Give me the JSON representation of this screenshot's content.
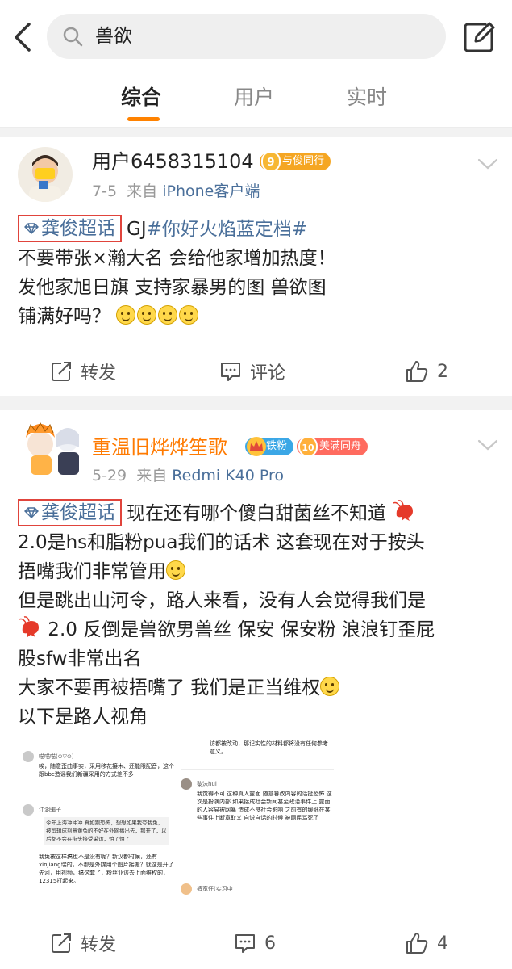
{
  "search": {
    "query": "兽欲"
  },
  "tabs": [
    {
      "label": "综合",
      "active": true
    },
    {
      "label": "用户",
      "active": false
    },
    {
      "label": "实时",
      "active": false
    }
  ],
  "posts": [
    {
      "username": "用户6458315104",
      "badges": [
        {
          "num": "9",
          "label": "与俊同行",
          "color": "#f5a623"
        }
      ],
      "date": "7-5",
      "source_prefix": "来自",
      "source": "iPhone客户端",
      "topic_tag": "龚俊超话",
      "lines": [
        "GJ",
        "#你好火焰蓝定档#",
        "不要带张×瀚大名 会给他家增加热度！",
        " 发他家旭日旗  支持家暴男的图 兽欲图",
        "铺满好吗？"
      ],
      "actions": {
        "repost": "转发",
        "comment": "评论",
        "like": "2"
      }
    },
    {
      "username": "重温旧烨烨笙歌",
      "badges": [
        {
          "label": "铁粉",
          "color": "#3ba7e6"
        },
        {
          "num": "10",
          "label": "美满同舟",
          "color": "#ff6b5f"
        }
      ],
      "date": "5-29",
      "source_prefix": "来自",
      "source": "Redmi K40 Pro",
      "topic_tag": "龚俊超话",
      "lines": [
        "现在还有哪个傻白甜菌丝不知道",
        "2.0是hs和脂粉pua我们的话术  这套现在对于按头",
        "捂嘴我们非常管用",
        "但是跳出山河令，路人来看，没有人会觉得我们是",
        " 2.0 反倒是兽欲男兽丝 保安 保安粉 浪浪钉歪屁",
        "股sfw非常出名",
        "大家不要再被捂嘴了 我们是正当维权",
        "以下是路人视角"
      ],
      "screenshot": {
        "left": {
          "c1_name": "喵喵喵(⊙▽⊙)",
          "c1_text": "唉，随意歪曲事实，采用移花接木、还能限配音，这个跟bbc造谣我们新疆采用的方式差不多",
          "c2_name": "江湖骗子",
          "c2_quote": "今年上海冲冲冲 真如跟恐怖，想想如果我夸我兔，被剪辑成刻意黄兔的不好在外网播出去，那开了，以后都不会在街头接受采访，怕了怕了",
          "c2_text": "我免被这样搞也不是没有呢？新汉都时候，还有xinjiang瑞的，不都是外媒用个图片接搬？就这是开了先河，用视频，搞这套了，粉丝业该去上面维权的，12315打起来。"
        },
        "right": {
          "top_text": "访都被改动，那记实性的材料都将没有任何参考意义。",
          "c1_name": "黎沫hui",
          "c1_text": "我觉得不可 这种真人露面 随意篡改内容的话挺恐怖 这次是扮演内部 如果接成社会新闻甚至政治事件上 露面的人容易被网暴 造成不良社会影响 之前有的缓纸在某些事件上断章取义 自说自话的时候 被网民骂死了",
          "c2_name": "裤宽仔(实习中"
        }
      },
      "actions": {
        "repost": "转发",
        "comment": "6",
        "like": "4"
      }
    }
  ],
  "colors": {
    "accent": "#ff8200",
    "link": "#4a6f9a",
    "tag_border": "#e0443c"
  }
}
